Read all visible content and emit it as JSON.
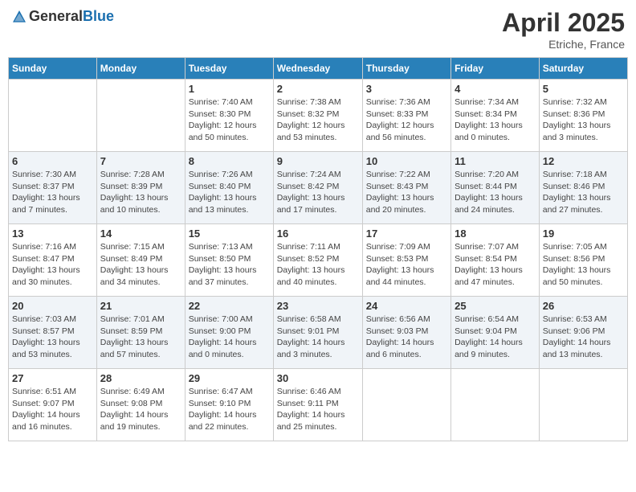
{
  "header": {
    "logo_general": "General",
    "logo_blue": "Blue",
    "month_title": "April 2025",
    "location": "Etriche, France"
  },
  "days_of_week": [
    "Sunday",
    "Monday",
    "Tuesday",
    "Wednesday",
    "Thursday",
    "Friday",
    "Saturday"
  ],
  "weeks": [
    [
      {
        "day": "",
        "sunrise": "",
        "sunset": "",
        "daylight": ""
      },
      {
        "day": "",
        "sunrise": "",
        "sunset": "",
        "daylight": ""
      },
      {
        "day": "1",
        "sunrise": "Sunrise: 7:40 AM",
        "sunset": "Sunset: 8:30 PM",
        "daylight": "Daylight: 12 hours and 50 minutes."
      },
      {
        "day": "2",
        "sunrise": "Sunrise: 7:38 AM",
        "sunset": "Sunset: 8:32 PM",
        "daylight": "Daylight: 12 hours and 53 minutes."
      },
      {
        "day": "3",
        "sunrise": "Sunrise: 7:36 AM",
        "sunset": "Sunset: 8:33 PM",
        "daylight": "Daylight: 12 hours and 56 minutes."
      },
      {
        "day": "4",
        "sunrise": "Sunrise: 7:34 AM",
        "sunset": "Sunset: 8:34 PM",
        "daylight": "Daylight: 13 hours and 0 minutes."
      },
      {
        "day": "5",
        "sunrise": "Sunrise: 7:32 AM",
        "sunset": "Sunset: 8:36 PM",
        "daylight": "Daylight: 13 hours and 3 minutes."
      }
    ],
    [
      {
        "day": "6",
        "sunrise": "Sunrise: 7:30 AM",
        "sunset": "Sunset: 8:37 PM",
        "daylight": "Daylight: 13 hours and 7 minutes."
      },
      {
        "day": "7",
        "sunrise": "Sunrise: 7:28 AM",
        "sunset": "Sunset: 8:39 PM",
        "daylight": "Daylight: 13 hours and 10 minutes."
      },
      {
        "day": "8",
        "sunrise": "Sunrise: 7:26 AM",
        "sunset": "Sunset: 8:40 PM",
        "daylight": "Daylight: 13 hours and 13 minutes."
      },
      {
        "day": "9",
        "sunrise": "Sunrise: 7:24 AM",
        "sunset": "Sunset: 8:42 PM",
        "daylight": "Daylight: 13 hours and 17 minutes."
      },
      {
        "day": "10",
        "sunrise": "Sunrise: 7:22 AM",
        "sunset": "Sunset: 8:43 PM",
        "daylight": "Daylight: 13 hours and 20 minutes."
      },
      {
        "day": "11",
        "sunrise": "Sunrise: 7:20 AM",
        "sunset": "Sunset: 8:44 PM",
        "daylight": "Daylight: 13 hours and 24 minutes."
      },
      {
        "day": "12",
        "sunrise": "Sunrise: 7:18 AM",
        "sunset": "Sunset: 8:46 PM",
        "daylight": "Daylight: 13 hours and 27 minutes."
      }
    ],
    [
      {
        "day": "13",
        "sunrise": "Sunrise: 7:16 AM",
        "sunset": "Sunset: 8:47 PM",
        "daylight": "Daylight: 13 hours and 30 minutes."
      },
      {
        "day": "14",
        "sunrise": "Sunrise: 7:15 AM",
        "sunset": "Sunset: 8:49 PM",
        "daylight": "Daylight: 13 hours and 34 minutes."
      },
      {
        "day": "15",
        "sunrise": "Sunrise: 7:13 AM",
        "sunset": "Sunset: 8:50 PM",
        "daylight": "Daylight: 13 hours and 37 minutes."
      },
      {
        "day": "16",
        "sunrise": "Sunrise: 7:11 AM",
        "sunset": "Sunset: 8:52 PM",
        "daylight": "Daylight: 13 hours and 40 minutes."
      },
      {
        "day": "17",
        "sunrise": "Sunrise: 7:09 AM",
        "sunset": "Sunset: 8:53 PM",
        "daylight": "Daylight: 13 hours and 44 minutes."
      },
      {
        "day": "18",
        "sunrise": "Sunrise: 7:07 AM",
        "sunset": "Sunset: 8:54 PM",
        "daylight": "Daylight: 13 hours and 47 minutes."
      },
      {
        "day": "19",
        "sunrise": "Sunrise: 7:05 AM",
        "sunset": "Sunset: 8:56 PM",
        "daylight": "Daylight: 13 hours and 50 minutes."
      }
    ],
    [
      {
        "day": "20",
        "sunrise": "Sunrise: 7:03 AM",
        "sunset": "Sunset: 8:57 PM",
        "daylight": "Daylight: 13 hours and 53 minutes."
      },
      {
        "day": "21",
        "sunrise": "Sunrise: 7:01 AM",
        "sunset": "Sunset: 8:59 PM",
        "daylight": "Daylight: 13 hours and 57 minutes."
      },
      {
        "day": "22",
        "sunrise": "Sunrise: 7:00 AM",
        "sunset": "Sunset: 9:00 PM",
        "daylight": "Daylight: 14 hours and 0 minutes."
      },
      {
        "day": "23",
        "sunrise": "Sunrise: 6:58 AM",
        "sunset": "Sunset: 9:01 PM",
        "daylight": "Daylight: 14 hours and 3 minutes."
      },
      {
        "day": "24",
        "sunrise": "Sunrise: 6:56 AM",
        "sunset": "Sunset: 9:03 PM",
        "daylight": "Daylight: 14 hours and 6 minutes."
      },
      {
        "day": "25",
        "sunrise": "Sunrise: 6:54 AM",
        "sunset": "Sunset: 9:04 PM",
        "daylight": "Daylight: 14 hours and 9 minutes."
      },
      {
        "day": "26",
        "sunrise": "Sunrise: 6:53 AM",
        "sunset": "Sunset: 9:06 PM",
        "daylight": "Daylight: 14 hours and 13 minutes."
      }
    ],
    [
      {
        "day": "27",
        "sunrise": "Sunrise: 6:51 AM",
        "sunset": "Sunset: 9:07 PM",
        "daylight": "Daylight: 14 hours and 16 minutes."
      },
      {
        "day": "28",
        "sunrise": "Sunrise: 6:49 AM",
        "sunset": "Sunset: 9:08 PM",
        "daylight": "Daylight: 14 hours and 19 minutes."
      },
      {
        "day": "29",
        "sunrise": "Sunrise: 6:47 AM",
        "sunset": "Sunset: 9:10 PM",
        "daylight": "Daylight: 14 hours and 22 minutes."
      },
      {
        "day": "30",
        "sunrise": "Sunrise: 6:46 AM",
        "sunset": "Sunset: 9:11 PM",
        "daylight": "Daylight: 14 hours and 25 minutes."
      },
      {
        "day": "",
        "sunrise": "",
        "sunset": "",
        "daylight": ""
      },
      {
        "day": "",
        "sunrise": "",
        "sunset": "",
        "daylight": ""
      },
      {
        "day": "",
        "sunrise": "",
        "sunset": "",
        "daylight": ""
      }
    ]
  ]
}
